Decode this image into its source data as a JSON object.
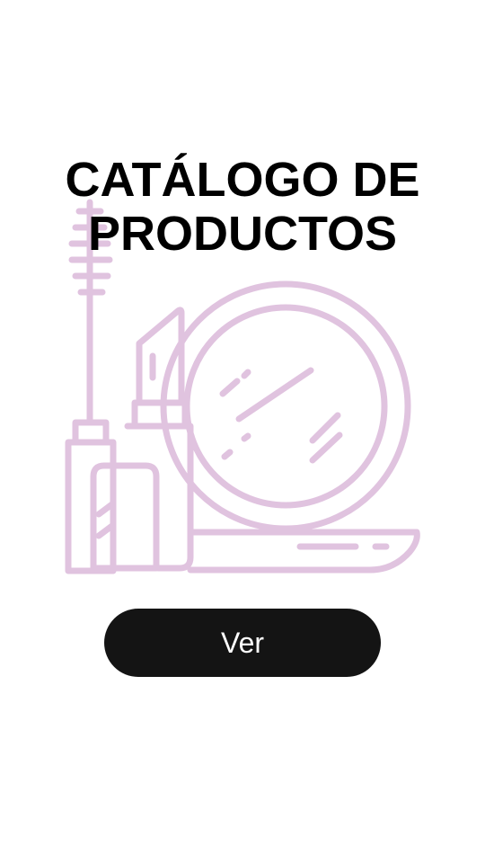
{
  "title": {
    "line1": "CATÁLOGO DE",
    "line2": "PRODUCTOS"
  },
  "illustration": {
    "icon": "makeup-products-icon",
    "stroke_color": "#e0c3df"
  },
  "cta": {
    "label": "Ver",
    "background": "#141414",
    "text_color": "#ffffff"
  }
}
